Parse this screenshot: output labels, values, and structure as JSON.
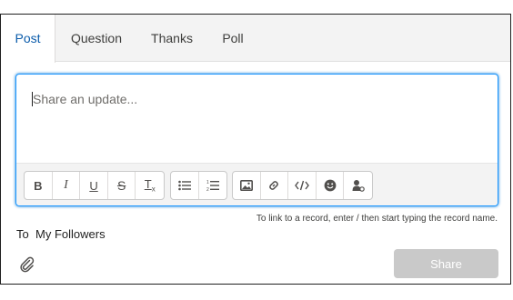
{
  "tabs": [
    {
      "label": "Post",
      "active": true
    },
    {
      "label": "Question",
      "active": false
    },
    {
      "label": "Thanks",
      "active": false
    },
    {
      "label": "Poll",
      "active": false
    }
  ],
  "composer": {
    "placeholder": "Share an update...",
    "toolbar": {
      "format": [
        "bold-icon",
        "italic-icon",
        "underline-icon",
        "strikethrough-icon",
        "clear-formatting-icon"
      ],
      "lists": [
        "bulleted-list-icon",
        "numbered-list-icon"
      ],
      "insert": [
        "image-icon",
        "link-icon",
        "code-icon",
        "emoji-icon",
        "mention-icon"
      ]
    }
  },
  "hint": "To link to a record, enter / then start typing the record name.",
  "to": {
    "label": "To",
    "value": "My Followers"
  },
  "share_label": "Share",
  "colors": {
    "accent": "#0b5cab",
    "focus_border": "#1b96ff",
    "disabled_button": "#c9c9c9"
  }
}
